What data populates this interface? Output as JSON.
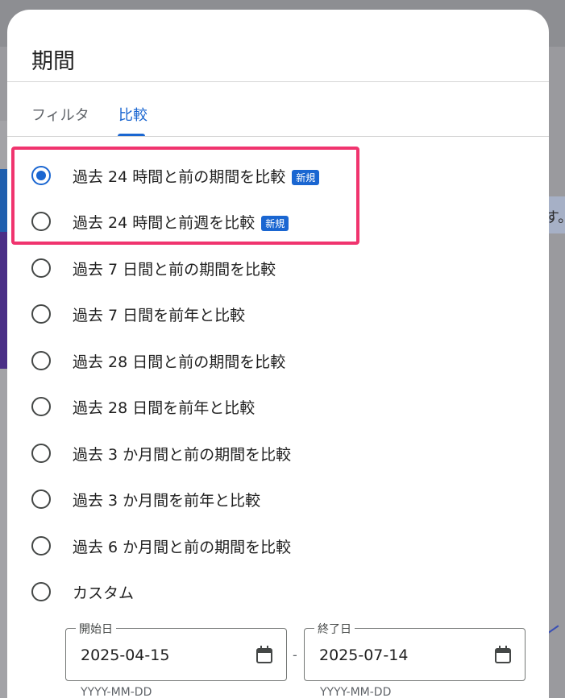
{
  "background": {
    "right_text": "す。"
  },
  "dialog": {
    "title": "期間",
    "tabs": [
      {
        "label": "フィルタ",
        "active": false
      },
      {
        "label": "比較",
        "active": true
      }
    ],
    "options": [
      {
        "label": "過去 24 時間と前の期間を比較",
        "badge": "新規",
        "selected": true
      },
      {
        "label": "過去 24 時間と前週を比較",
        "badge": "新規",
        "selected": false
      },
      {
        "label": "過去 7 日間と前の期間を比較",
        "badge": "",
        "selected": false
      },
      {
        "label": "過去 7 日間を前年と比較",
        "badge": "",
        "selected": false
      },
      {
        "label": "過去 28 日間と前の期間を比較",
        "badge": "",
        "selected": false
      },
      {
        "label": "過去 28 日間を前年と比較",
        "badge": "",
        "selected": false
      },
      {
        "label": "過去 3 か月間と前の期間を比較",
        "badge": "",
        "selected": false
      },
      {
        "label": "過去 3 か月間を前年と比較",
        "badge": "",
        "selected": false
      },
      {
        "label": "過去 6 か月間と前の期間を比較",
        "badge": "",
        "selected": false
      },
      {
        "label": "カスタム",
        "badge": "",
        "selected": false
      }
    ],
    "date_range": {
      "start_label": "開始日",
      "start_value": "2025-04-15",
      "start_helper": "YYYY-MM-DD",
      "separator": "-",
      "end_label": "終了日",
      "end_value": "2025-07-14",
      "end_helper": "YYYY-MM-DD"
    }
  },
  "colors": {
    "accent": "#1a66d1",
    "highlight": "#f0346e"
  }
}
